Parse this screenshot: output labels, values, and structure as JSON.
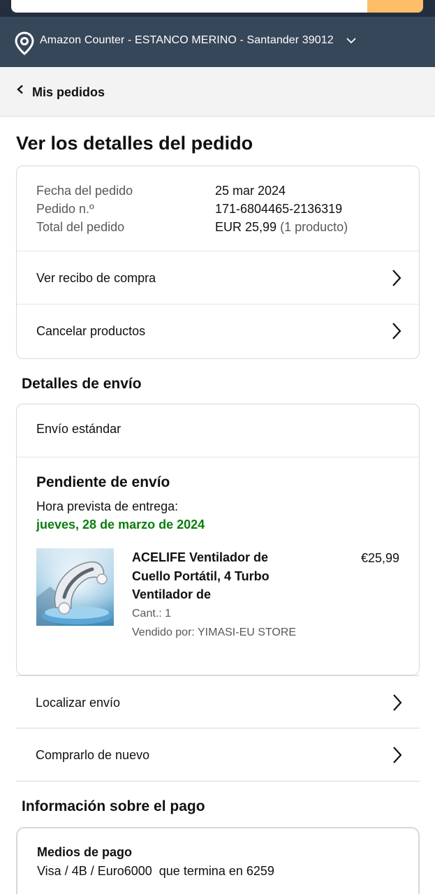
{
  "header": {
    "location_text": "Amazon Counter - ESTANCO MERINO - Santander 39012",
    "location_icon": "location-pin-icon",
    "chevron_icon": "chevron-down-icon"
  },
  "breadcrumb": {
    "label": "Mis pedidos",
    "icon": "chevron-left-icon"
  },
  "page_title": "Ver los detalles del pedido",
  "summary": {
    "rows": [
      {
        "label": "Fecha del pedido",
        "value": "25 mar 2024",
        "sub": ""
      },
      {
        "label": "Pedido n.º",
        "value": "171-6804465-2136319",
        "sub": ""
      },
      {
        "label": "Total del pedido",
        "value": "EUR 25,99",
        "sub": "(1 producto)"
      }
    ],
    "actions": [
      {
        "label": "Ver recibo de compra",
        "icon": "chevron-right-icon"
      },
      {
        "label": "Cancelar productos",
        "icon": "chevron-right-icon"
      }
    ]
  },
  "shipping": {
    "section_title": "Detalles de envío",
    "method": "Envío estándar",
    "status": "Pendiente de envío",
    "eta_label": "Hora prevista de entrega:",
    "eta_date": "jueves, 28 de marzo de 2024",
    "product": {
      "title": "ACELIFE Ventilador de Cuello Portátil, 4 Turbo Ventilador de",
      "price": "€25,99",
      "qty": "Cant.: 1",
      "seller": "Vendido por: YIMASI-EU STORE",
      "image_icon": "neck-fan-product-image"
    },
    "actions": [
      {
        "label": "Localizar envío",
        "icon": "chevron-right-icon"
      },
      {
        "label": "Comprarlo de nuevo",
        "icon": "chevron-right-icon"
      }
    ]
  },
  "payment": {
    "section_title": "Información sobre el pago",
    "method_heading": "Medios de pago",
    "method_value": "Visa / 4B / Euro6000  que termina en 6259"
  },
  "colors": {
    "header_dark": "#232f3e",
    "location_bar": "#37475a",
    "search_button": "#febd69",
    "delivery_green": "#0d7e0f",
    "border": "#d5d9d9"
  }
}
